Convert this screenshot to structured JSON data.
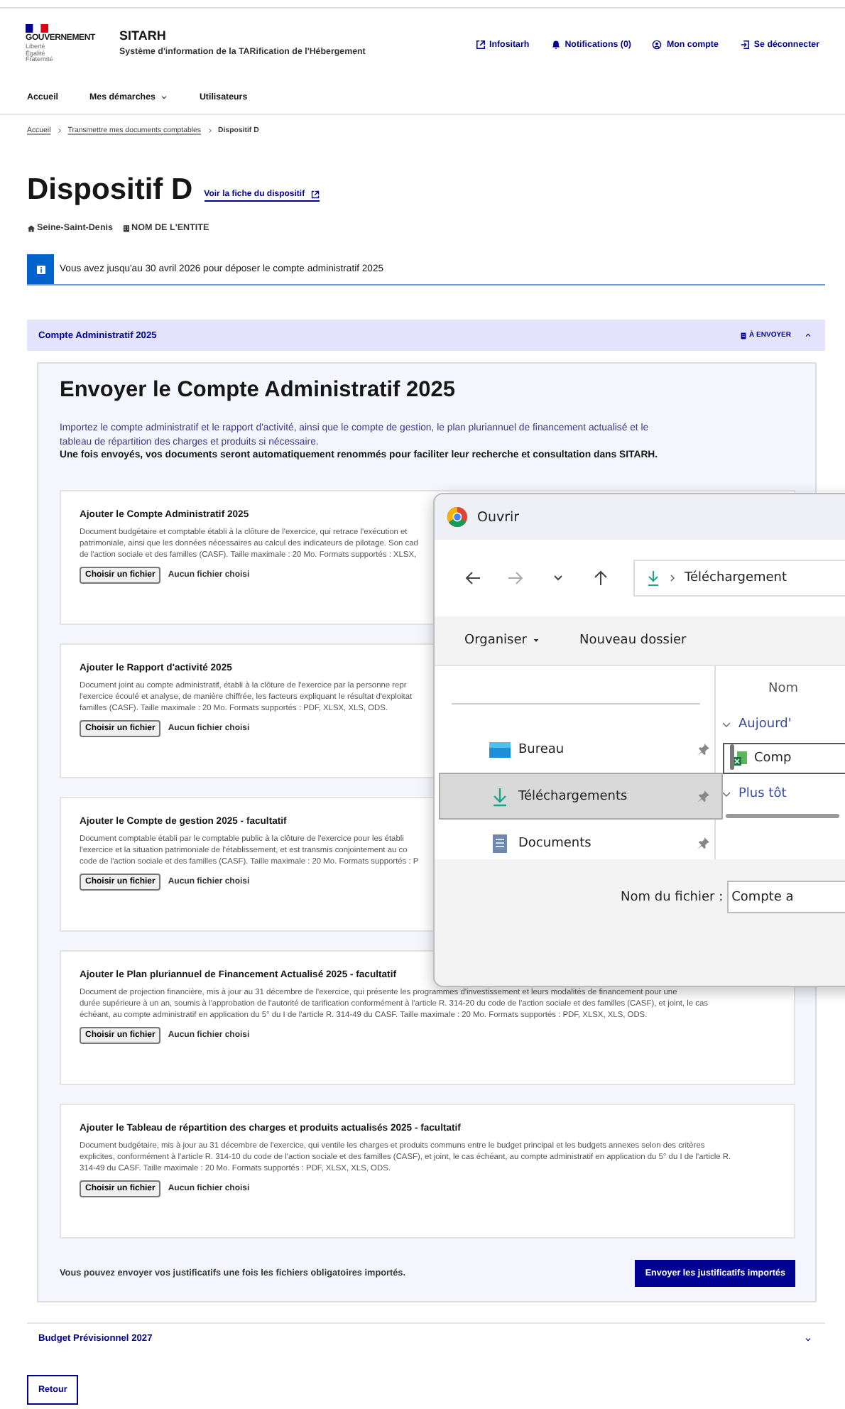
{
  "header": {
    "logo": {
      "name": "GOUVERNEMENT",
      "motto": [
        "Liberté",
        "Égalité",
        "Fraternité"
      ]
    },
    "app_name": "SITARH",
    "app_subtitle": "Système d'information de la TARification de l'Hébergement",
    "links": [
      {
        "label": "Infositarh"
      },
      {
        "label": "Notifications (0)"
      },
      {
        "label": "Mon compte"
      },
      {
        "label": "Se déconnecter"
      }
    ]
  },
  "nav": [
    {
      "label": "Accueil",
      "dropdown": false
    },
    {
      "label": "Mes démarches",
      "dropdown": true
    },
    {
      "label": "Utilisateurs",
      "dropdown": false
    }
  ],
  "breadcrumb": [
    {
      "label": "Accueil",
      "current": false
    },
    {
      "label": "Transmettre mes documents comptables",
      "current": false
    },
    {
      "label": "Dispositif D",
      "current": true
    }
  ],
  "page_title": "Dispositif D",
  "sheet_link": "Voir la fiche du dispositif",
  "tags": [
    "Seine-Saint-Denis",
    "NOM DE L'ENTITE"
  ],
  "alert": "Vous avez jusqu'au 30 avril 2026 pour déposer le compte administratif 2025",
  "accordions": [
    {
      "title": "Compte Administratif 2025",
      "expanded": true,
      "badge": "À ENVOYER",
      "panel": {
        "title": "Envoyer le Compte Administratif 2025",
        "intro": [
          "Importez le compte administratif et le rapport d'activité, ainsi que le compte de gestion, le plan pluriannuel de financement actualisé et le",
          "tableau de répartition des charges et produits si nécessaire.",
          "Une fois envoyés, vos documents seront automatiquement renommés pour faciliter leur recherche et consultation dans SITARH."
        ],
        "uploads": [
          {
            "title": "Ajouter le Compte Administratif 2025",
            "description": [
              "Document budgétaire et comptable établi à la clôture de l'exercice, qui retrace l'exécution et",
              "patrimoniale, ainsi que les données nécessaires au calcul des indicateurs de pilotage. Son cad",
              "de l'action sociale et des familles (CASF). Taille maximale : 20 Mo. Formats supportés : XLSX,"
            ],
            "button": "Choisir un fichier",
            "file": "Aucun fichier choisi"
          },
          {
            "title": "Ajouter le Rapport d'activité 2025",
            "description": [
              "Document joint au compte administratif, établi à la clôture de l'exercice par la personne repr",
              "l'exercice écoulé et analyse, de manière chiffrée, les facteurs expliquant le résultat d'exploitat",
              "familles (CASF). Taille maximale : 20 Mo. Formats supportés : PDF, XLSX, XLS, ODS."
            ],
            "button": "Choisir un fichier",
            "file": "Aucun fichier choisi"
          },
          {
            "title": "Ajouter le Compte de gestion 2025 - facultatif",
            "description": [
              "Document comptable établi par le comptable public à la clôture de l'exercice pour les établi",
              "l'exercice et la situation patrimoniale de l'établissement, et est transmis conjointement au co",
              "code de l'action sociale et des familles (CASF). Taille maximale : 20 Mo. Formats supportés : P"
            ],
            "button": "Choisir un fichier",
            "file": "Aucun fichier choisi"
          },
          {
            "title": "Ajouter le Plan pluriannuel de Financement Actualisé 2025 - facultatif",
            "description": [
              "Document de projection financière, mis à jour au 31 décembre de l'exercice, qui présente les programmes d'investissement et leurs modalités de financement pour une",
              "durée supérieure à un an, soumis à l'approbation de l'autorité de tarification conformément à l'article R. 314-20 du code de l'action sociale et des familles (CASF), et joint, le cas",
              "échéant, au compte administratif en application du 5° du I de l'article R. 314-49 du CASF. Taille maximale : 20 Mo. Formats supportés : PDF, XLSX, XLS, ODS."
            ],
            "button": "Choisir un fichier",
            "file": "Aucun fichier choisi"
          },
          {
            "title": "Ajouter le Tableau de répartition des charges et produits actualisés 2025 - facultatif",
            "description": [
              "Document budgétaire, mis à jour au 31 décembre de l'exercice, qui ventile les charges et produits communs entre le budget principal et les budgets annexes selon des critères",
              "explicites, conformément à l'article R. 314-10 du code de l'action sociale et des familles (CASF), et joint, le cas échéant, au compte administratif en application du 5° du I de l'article R.",
              "314-49 du CASF. Taille maximale : 20 Mo. Formats supportés : PDF, XLSX, XLS, ODS."
            ],
            "button": "Choisir un fichier",
            "file": "Aucun fichier choisi"
          }
        ],
        "footer_note": "Vous pouvez envoyer vos justificatifs une fois les fichiers obligatoires importés.",
        "submit": "Envoyer les justificatifs importés"
      }
    },
    {
      "title": "Budget Prévisionnel 2027",
      "expanded": false
    }
  ],
  "back_button": "Retour",
  "dialog": {
    "title": "Ouvrir",
    "path": "Téléchargement",
    "organize": "Organiser",
    "new_folder": "Nouveau dossier",
    "nav_items": [
      {
        "label": "Bureau",
        "selected": false
      },
      {
        "label": "Téléchargements",
        "selected": true
      },
      {
        "label": "Documents",
        "selected": false
      }
    ],
    "column": "Nom",
    "groups": [
      {
        "label": "Aujourd'",
        "files": [
          "Comp"
        ]
      },
      {
        "label": "Plus tôt"
      }
    ],
    "filename_label": "Nom du fichier :",
    "filename": "Compte a"
  }
}
